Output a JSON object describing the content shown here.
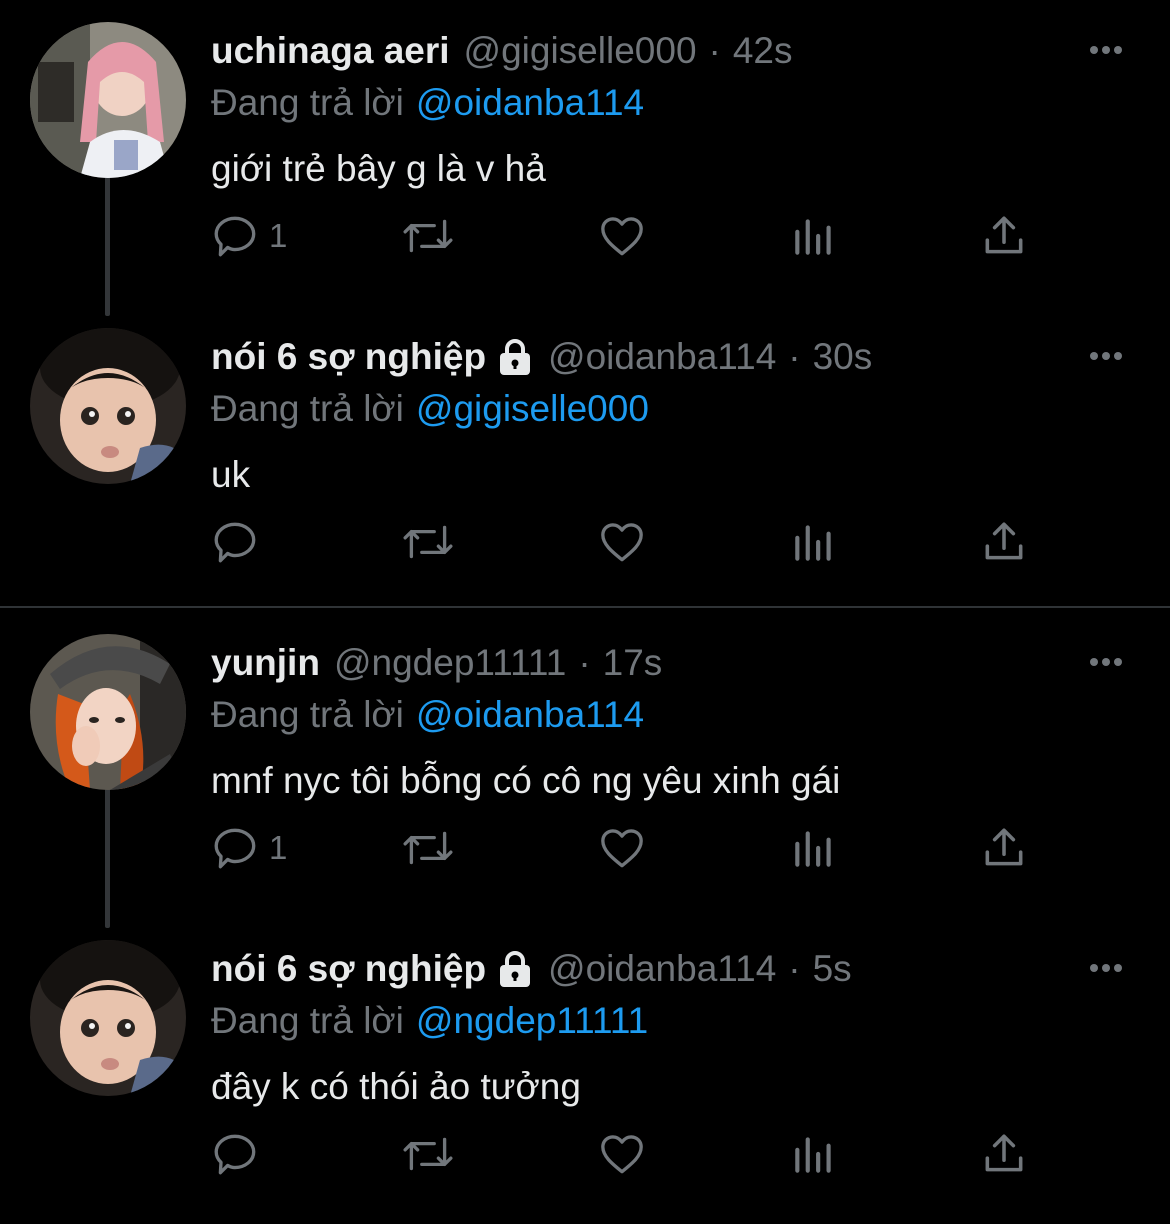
{
  "colors": {
    "background": "#000000",
    "text_primary": "#e7e9ea",
    "text_secondary": "#71767b",
    "accent": "#1d9bf0",
    "thread_line": "#333639",
    "divider": "#2f3336"
  },
  "tweets": [
    {
      "display_name": "uchinaga aeri",
      "locked": false,
      "handle": "@gigiselle000",
      "separator": "·",
      "time": "42s",
      "reply_prefix": "Đang trả lời",
      "reply_to": "@oidanba114",
      "text": "giới trẻ bây g là v hả",
      "reply_count": "1",
      "avatar_icon": "avatar-pink-hair"
    },
    {
      "display_name": "nói 6 sợ nghiệp",
      "locked": true,
      "handle": "@oidanba114",
      "separator": "·",
      "time": "30s",
      "reply_prefix": "Đang trả lời",
      "reply_to": "@gigiselle000",
      "text": "uk",
      "reply_count": "",
      "avatar_icon": "avatar-baby"
    },
    {
      "display_name": "yunjin",
      "locked": false,
      "handle": "@ngdep11111",
      "separator": "·",
      "time": "17s",
      "reply_prefix": "Đang trả lời",
      "reply_to": "@oidanba114",
      "text": "mnf nyc tôi bỗng có cô ng yêu xinh gái",
      "reply_count": "1",
      "avatar_icon": "avatar-orange-hair-cap"
    },
    {
      "display_name": "nói 6 sợ nghiệp",
      "locked": true,
      "handle": "@oidanba114",
      "separator": "·",
      "time": "5s",
      "reply_prefix": "Đang trả lời",
      "reply_to": "@ngdep11111",
      "text": "đây k có thói ảo tưởng",
      "reply_count": "",
      "avatar_icon": "avatar-baby"
    }
  ],
  "action_icons": [
    "reply-icon",
    "retweet-icon",
    "like-icon",
    "analytics-icon",
    "share-icon"
  ],
  "more_icon": "more-options-icon",
  "lock_icon": "lock-icon"
}
